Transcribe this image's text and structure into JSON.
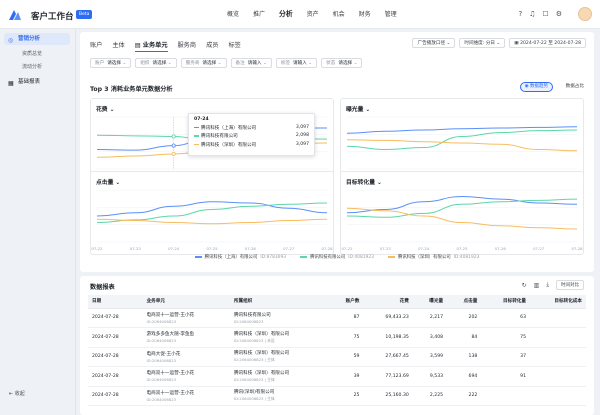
{
  "app": {
    "title": "客户工作台",
    "badge": "Beta"
  },
  "nav": [
    "概览",
    "推广",
    "分析",
    "资产",
    "机会",
    "财务",
    "管理"
  ],
  "nav_active": "分析",
  "sidebar": {
    "items": [
      {
        "label": "营销分析",
        "active": true,
        "icon": "chart-icon"
      },
      {
        "label": "资质总览",
        "sub": true
      },
      {
        "label": "流动分析",
        "sub": true
      },
      {
        "label": "基础报表",
        "active": false,
        "icon": "table-icon"
      }
    ],
    "collapse": "收起"
  },
  "tabs": [
    "账户",
    "主体",
    "业务单元",
    "服务商",
    "成员",
    "标签"
  ],
  "tab_active": "业务单元",
  "right_filters": {
    "caliber": "广告播放口径",
    "granularity": "时间维度: 分日",
    "date_range": "2024-07-22 至 2024-07-28"
  },
  "filters": [
    {
      "label": "账户",
      "value": "请选择"
    },
    {
      "label": "组织",
      "value": "请选择"
    },
    {
      "label": "服务商",
      "value": "请选择"
    },
    {
      "label": "备注",
      "value": "请输入"
    },
    {
      "label": "标签",
      "value": "请输入"
    },
    {
      "label": "状态",
      "value": "请选择"
    }
  ],
  "section": {
    "title": "Top 3 消耗业务单元数据分析",
    "toggle_active": "数据趋势",
    "toggle_other": "数据占比"
  },
  "panels": [
    {
      "title": "花费"
    },
    {
      "title": "曝光量"
    },
    {
      "title": "点击量"
    },
    {
      "title": "目标转化量"
    }
  ],
  "colors": {
    "series1": "#5b8ff9",
    "series2": "#5ad8a6",
    "series3": "#f6bd60",
    "accent": "#2f6cf5"
  },
  "chart_data": [
    {
      "type": "line",
      "title": "花费",
      "x": [
        "07-22",
        "07-23",
        "07-24",
        "07-25",
        "07-26",
        "07-27",
        "07-28"
      ],
      "series": [
        {
          "name": "腾讯科技（上海）有限公司",
          "values": [
            30,
            29,
            36,
            50,
            60,
            63,
            63
          ]
        },
        {
          "name": "腾讯科技有限公司",
          "values": [
            52,
            51,
            50,
            42,
            46,
            47,
            46
          ]
        },
        {
          "name": "腾讯科技（深圳）有限公司",
          "values": [
            18,
            20,
            23,
            28,
            35,
            38,
            40
          ]
        }
      ]
    },
    {
      "type": "line",
      "title": "曝光量",
      "x": [
        "07-22",
        "07-23",
        "07-24",
        "07-25",
        "07-26",
        "07-27",
        "07-28"
      ],
      "series": [
        {
          "name": "腾讯科技（上海）有限公司",
          "values": [
            55,
            58,
            60,
            62,
            63,
            64,
            65
          ]
        },
        {
          "name": "腾讯科技有限公司",
          "values": [
            35,
            30,
            33,
            50,
            56,
            59,
            60
          ]
        },
        {
          "name": "腾讯科技（深圳）有限公司",
          "values": [
            45,
            44,
            42,
            40,
            38,
            30,
            28
          ]
        }
      ]
    },
    {
      "type": "line",
      "title": "点击量",
      "x": [
        "07-22",
        "07-23",
        "07-24",
        "07-25",
        "07-26",
        "07-27",
        "07-28"
      ],
      "series": [
        {
          "name": "腾讯科技（上海）有限公司",
          "values": [
            40,
            45,
            55,
            62,
            60,
            52,
            45
          ]
        },
        {
          "name": "腾讯科技有限公司",
          "values": [
            30,
            34,
            40,
            50,
            55,
            58,
            60
          ]
        },
        {
          "name": "腾讯科技（深圳）有限公司",
          "values": [
            35,
            33,
            30,
            28,
            30,
            33,
            35
          ]
        }
      ]
    },
    {
      "type": "line",
      "title": "目标转化量",
      "x": [
        "07-22",
        "07-23",
        "07-24",
        "07-25",
        "07-26",
        "07-27",
        "07-28"
      ],
      "series": [
        {
          "name": "腾讯科技（上海）有限公司",
          "values": [
            45,
            50,
            62,
            70,
            66,
            60,
            58
          ]
        },
        {
          "name": "腾讯科技有限公司",
          "values": [
            40,
            38,
            44,
            58,
            62,
            64,
            66
          ]
        },
        {
          "name": "腾讯科技（深圳）有限公司",
          "values": [
            52,
            48,
            40,
            30,
            25,
            22,
            20
          ]
        }
      ]
    }
  ],
  "tooltip": {
    "date": "07-24",
    "rows": [
      {
        "name": "腾讯科技（上海）有限公司",
        "value": "3,097"
      },
      {
        "name": "腾讯科技有限公司",
        "value": "2,098"
      },
      {
        "name": "腾讯科技（深圳）有限公司",
        "value": "3,097"
      }
    ]
  },
  "legend": [
    {
      "name": "腾讯科技（上海）有限公司",
      "id": "ID:8783693"
    },
    {
      "name": "腾讯科技有限公司",
      "id": "ID:4081923"
    },
    {
      "name": "腾讯科技（深圳）有限公司",
      "id": "ID:4081923"
    }
  ],
  "report": {
    "title": "数据报表",
    "tools_btn": "时间对比",
    "columns": [
      "日期",
      "业务单元",
      "所属组织",
      "账户数",
      "花费",
      "曝光量",
      "点击量",
      "目标转化量",
      "目标转化成本"
    ],
    "rows": [
      {
        "date": "2024-07-28",
        "unit": "电商双十一运营-王小花",
        "unit_id": "ID:2064006823",
        "org": "腾讯科技有限公司",
        "org_id": "ID:2064006823",
        "accounts": "87",
        "cost": "69,433.23",
        "impr": "2,217",
        "clicks": "202",
        "conv": "63",
        "cpa": ""
      },
      {
        "date": "2024-07-28",
        "unit": "游戏多多鱼大随-李鱼鱼",
        "unit_id": "ID:2064006823",
        "org": "腾讯科技（深圳）有限公司",
        "org_id": "ID:2064006823 | 未设",
        "accounts": "75",
        "cost": "10,198.35",
        "impr": "3,408",
        "clicks": "84",
        "conv": "75",
        "cpa": ""
      },
      {
        "date": "2024-07-28",
        "unit": "电商大促-王小花",
        "unit_id": "ID:2064006823",
        "org": "腾讯科技（深圳）有限公司",
        "org_id": "ID:2064006823 | 主体",
        "accounts": "59",
        "cost": "27,667.45",
        "impr": "3,599",
        "clicks": "138",
        "conv": "37",
        "cpa": ""
      },
      {
        "date": "2024-07-28",
        "unit": "电商双十一运营-王小花",
        "unit_id": "ID:2064006823",
        "org": "腾讯科技（深圳）有限公司",
        "org_id": "ID:2064006823 | 主体",
        "accounts": "39",
        "cost": "77,123.69",
        "impr": "9,533",
        "clicks": "694",
        "conv": "91",
        "cpa": ""
      },
      {
        "date": "2024-07-28",
        "unit": "电商双十一运营-王小花",
        "unit_id": "ID:2064006823",
        "org": "腾讯(深圳)有限公司",
        "org_id": "ID:2064006823 | 主体",
        "accounts": "25",
        "cost": "25,160.30",
        "impr": "2,225",
        "clicks": "222",
        "conv": "",
        "cpa": ""
      }
    ]
  }
}
